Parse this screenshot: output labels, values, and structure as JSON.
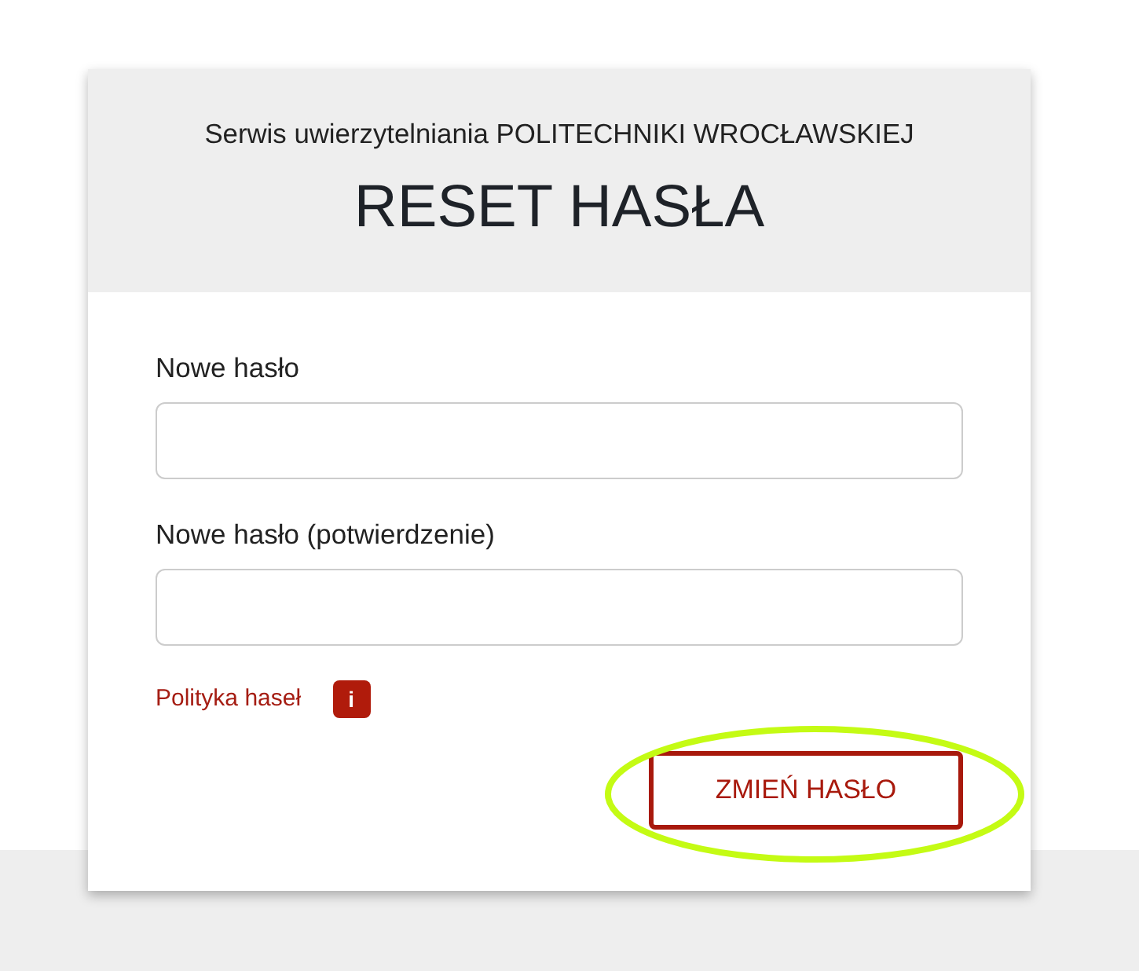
{
  "header": {
    "subtitle": "Serwis uwierzytelniania POLITECHNIKI WROCŁAWSKIEJ",
    "title": "RESET HASŁA"
  },
  "fields": [
    {
      "label": "Nowe hasło"
    },
    {
      "label": "Nowe hasło (potwierdzenie)"
    }
  ],
  "policy": {
    "link": "Polityka haseł",
    "info": "i"
  },
  "submit_button": {
    "label": "ZMIEŃ HASŁO",
    "highlighted": true
  }
}
